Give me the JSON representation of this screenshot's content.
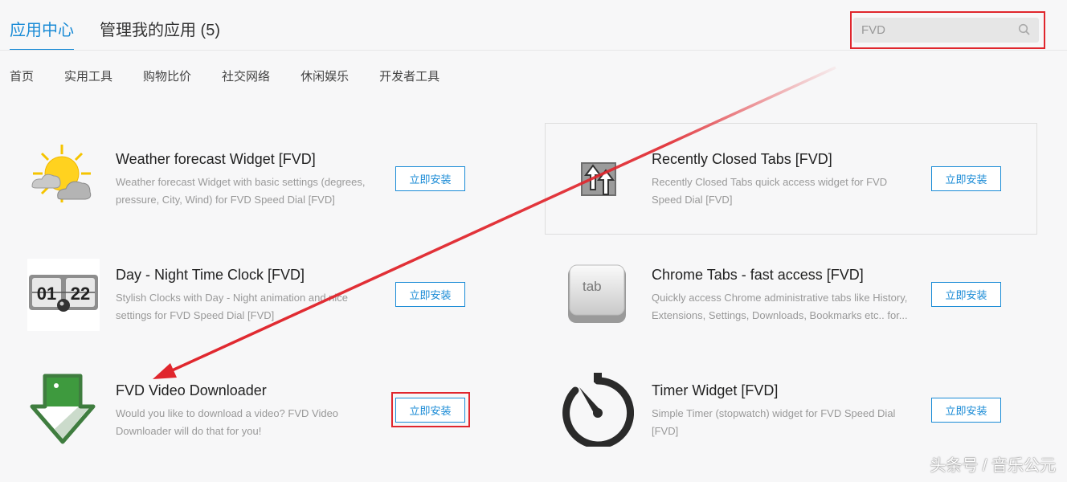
{
  "tabs": [
    {
      "label": "应用中心"
    },
    {
      "label": "管理我的应用 (5)"
    }
  ],
  "search": {
    "value": "FVD",
    "placeholder": ""
  },
  "categories": [
    "首页",
    "实用工具",
    "购物比价",
    "社交网络",
    "休闲娱乐",
    "开发者工具"
  ],
  "apps": [
    {
      "title": "Weather forecast Widget [FVD]",
      "desc": "Weather forecast Widget with basic settings (degrees, pressure, City, Wind) for FVD Speed Dial [FVD]",
      "button": "立即安装",
      "icon": "weather-icon"
    },
    {
      "title": "Recently Closed Tabs [FVD]",
      "desc": "Recently Closed Tabs quick access widget for FVD Speed Dial [FVD]",
      "button": "立即安装",
      "icon": "recent-tabs-icon"
    },
    {
      "title": "Day - Night Time Clock [FVD]",
      "desc": "Stylish Clocks with Day - Night animation and nice settings for FVD Speed Dial [FVD]",
      "button": "立即安装",
      "icon": "clock-icon",
      "clock_hour": "01",
      "clock_min": "22"
    },
    {
      "title": "Chrome Tabs - fast access [FVD]",
      "desc": "Quickly access Chrome administrative tabs like History, Extensions, Settings, Downloads, Bookmarks etc.. for...",
      "button": "立即安装",
      "icon": "tab-key-icon",
      "key_label": "tab"
    },
    {
      "title": "FVD Video Downloader",
      "desc": "Would you like to download a video? FVD Video Downloader will do that for you!",
      "button": "立即安装",
      "icon": "download-arrow-icon"
    },
    {
      "title": "Timer Widget [FVD]",
      "desc": "Simple Timer (stopwatch) widget for FVD Speed Dial [FVD]",
      "button": "立即安装",
      "icon": "stopwatch-icon"
    }
  ],
  "watermark": "头条号 / 音乐公元",
  "colors": {
    "accent": "#1a8bd6",
    "annotation": "#e0262d"
  }
}
